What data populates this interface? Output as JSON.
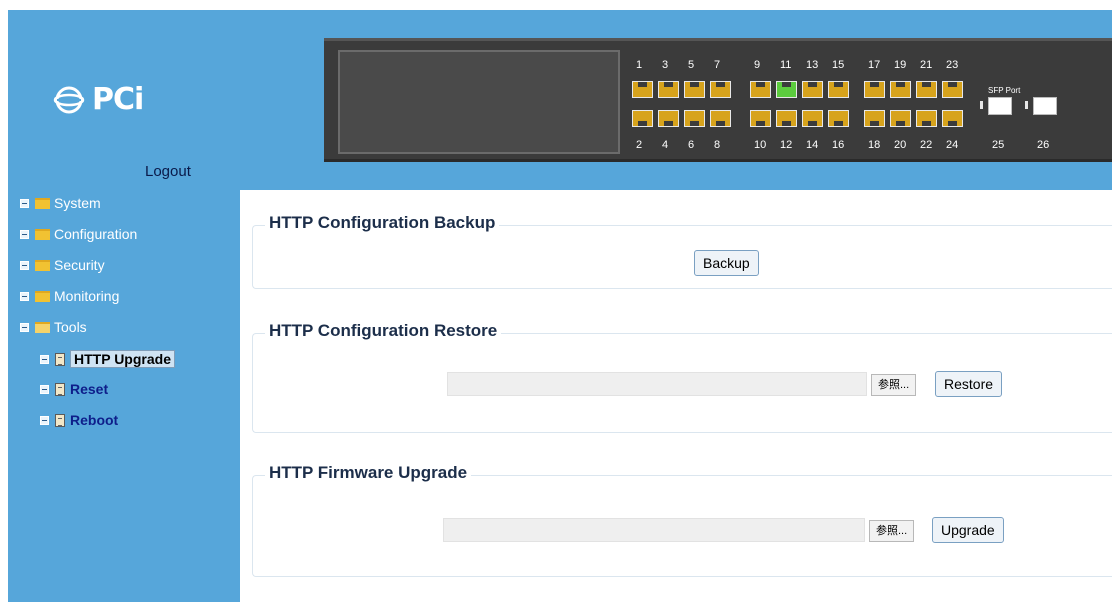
{
  "brand": {
    "logo_text": "PCi"
  },
  "header": {
    "logout_label": "Logout"
  },
  "device": {
    "top_port_numbers": [
      "1",
      "3",
      "5",
      "7",
      "9",
      "11",
      "13",
      "15",
      "17",
      "19",
      "21",
      "23"
    ],
    "bottom_port_numbers": [
      "2",
      "4",
      "6",
      "8",
      "10",
      "12",
      "14",
      "16",
      "18",
      "20",
      "22",
      "24"
    ],
    "active_port": "11",
    "sfp_label": "SFP Port",
    "sfp_port_numbers": [
      "25",
      "26"
    ],
    "colors": {
      "port_idle": "#d7a31c",
      "port_active": "#5ccc3e",
      "panel": "#3b3b3b"
    }
  },
  "sidebar": {
    "items": [
      {
        "label": "System",
        "icon": "folder-icon"
      },
      {
        "label": "Configuration",
        "icon": "folder-icon"
      },
      {
        "label": "Security",
        "icon": "folder-icon"
      },
      {
        "label": "Monitoring",
        "icon": "folder-icon"
      },
      {
        "label": "Tools",
        "icon": "folder-open-icon",
        "expanded": true
      }
    ],
    "subitems": [
      {
        "label": "HTTP Upgrade",
        "icon": "document-icon",
        "selected": true
      },
      {
        "label": "Reset",
        "icon": "document-icon"
      },
      {
        "label": "Reboot",
        "icon": "document-icon"
      }
    ]
  },
  "main": {
    "backup": {
      "title": "HTTP Configuration Backup",
      "button_label": "Backup"
    },
    "restore": {
      "title": "HTTP Configuration Restore",
      "file_value": "",
      "browse_label": "参照...",
      "button_label": "Restore"
    },
    "upgrade": {
      "title": "HTTP Firmware Upgrade",
      "file_value": "",
      "browse_label": "参照...",
      "button_label": "Upgrade"
    }
  },
  "colors": {
    "sidebar_bg": "#56a6da",
    "content_bg": "#ffffff",
    "heading": "#1c2e4a",
    "submenu_text": "#0e1e8a"
  }
}
